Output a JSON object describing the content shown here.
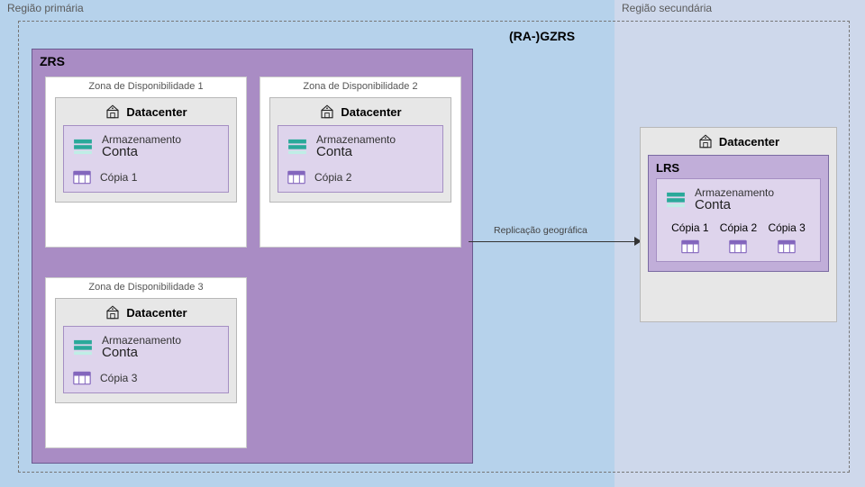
{
  "region_primary_label": "Região primária",
  "region_secondary_label": "Região secundária",
  "gzrs_label": "(RA-)GZRS",
  "zrs_label": "ZRS",
  "zones": [
    {
      "label": "Zona de Disponibilidade 1",
      "datacenter": "Datacenter",
      "storage": "Armazenamento",
      "account": "Conta",
      "copy": "Cópia 1"
    },
    {
      "label": "Zona de Disponibilidade 2",
      "datacenter": "Datacenter",
      "storage": "Armazenamento",
      "account": "Conta",
      "copy": "Cópia 2"
    },
    {
      "label": "Zona de Disponibilidade 3",
      "datacenter": "Datacenter",
      "storage": "Armazenamento",
      "account": "Conta",
      "copy": "Cópia 3"
    }
  ],
  "geo_replication_label": "Replicação geográfica",
  "secondary": {
    "datacenter": "Datacenter",
    "lrs_label": "LRS",
    "storage": "Armazenamento",
    "account": "Conta",
    "copies": [
      "Cópia 1",
      "Cópia 2",
      "Cópia 3"
    ]
  }
}
